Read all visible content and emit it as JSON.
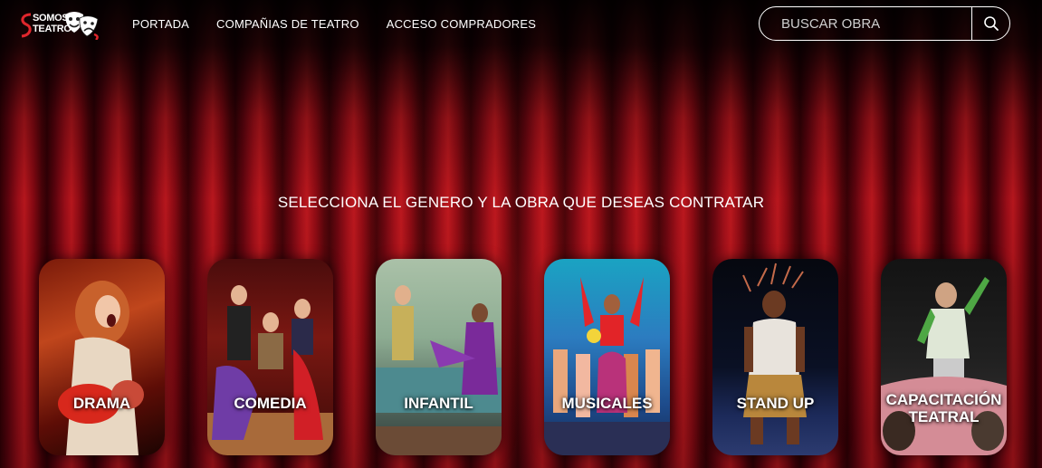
{
  "brand": {
    "logo_line1": "SOMOS",
    "logo_line2": "TEATRO"
  },
  "nav": {
    "items": [
      "PORTADA",
      "COMPAÑIAS DE TEATRO",
      "ACCESO COMPRADORES"
    ]
  },
  "search": {
    "placeholder": "BUSCAR OBRA"
  },
  "headline": "SELECCIONA EL GENERO Y LA OBRA QUE DESEAS CONTRATAR",
  "genres": [
    {
      "label": "DRAMA"
    },
    {
      "label": "COMEDIA"
    },
    {
      "label": "INFANTIL"
    },
    {
      "label": "MUSICALES"
    },
    {
      "label": "STAND UP"
    },
    {
      "label_line1": "CAPACITACIÓN",
      "label_line2": "TEATRAL"
    }
  ]
}
